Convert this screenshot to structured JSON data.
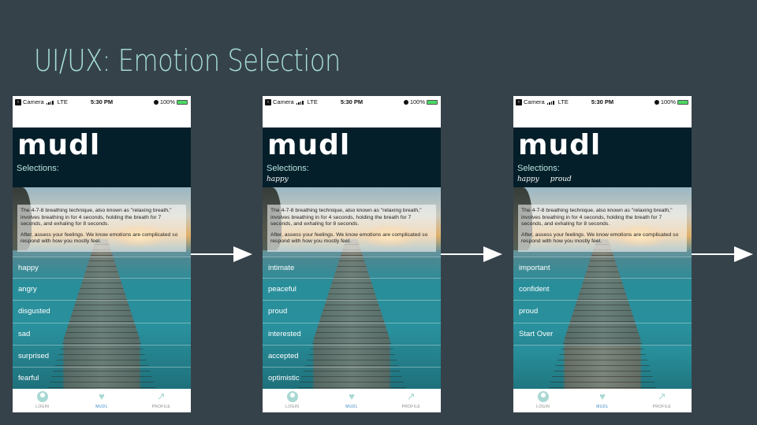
{
  "slide": {
    "title": "UI/UX: Emotion Selection"
  },
  "status": {
    "carrier": "Camera",
    "network": "LTE",
    "time": "5:30 PM",
    "battery": "100%"
  },
  "app": {
    "logo": "mudl",
    "selections_label": "Selections:",
    "info_p1": "The 4-7-8 breathing technique, also known as \"relaxing breath,\" involves breathing in for 4 seconds, holding the breath for 7 seconds, and exhaling for 8 seconds.",
    "info_p2": "After, assess your feelings. We know emotions are complicated so respond with how you mostly feel."
  },
  "tabs": {
    "login": "LOGIN",
    "mudl": "MUDL",
    "profile": "PROFILE"
  },
  "screens": [
    {
      "selections": [
        "",
        ""
      ],
      "emotions": [
        "happy",
        "angry",
        "disgusted",
        "sad",
        "surprised",
        "fearful"
      ]
    },
    {
      "selections": [
        "happy",
        ""
      ],
      "emotions": [
        "intimate",
        "peaceful",
        "proud",
        "interested",
        "accepted",
        "optimistic"
      ]
    },
    {
      "selections": [
        "happy",
        "proud"
      ],
      "emotions": [
        "important",
        "confident",
        "proud",
        "Start Over"
      ]
    }
  ],
  "colors": {
    "background": "#36424a",
    "title": "#a4dcd6",
    "header": "#041f2a",
    "tab_active": "#3a88c8"
  }
}
